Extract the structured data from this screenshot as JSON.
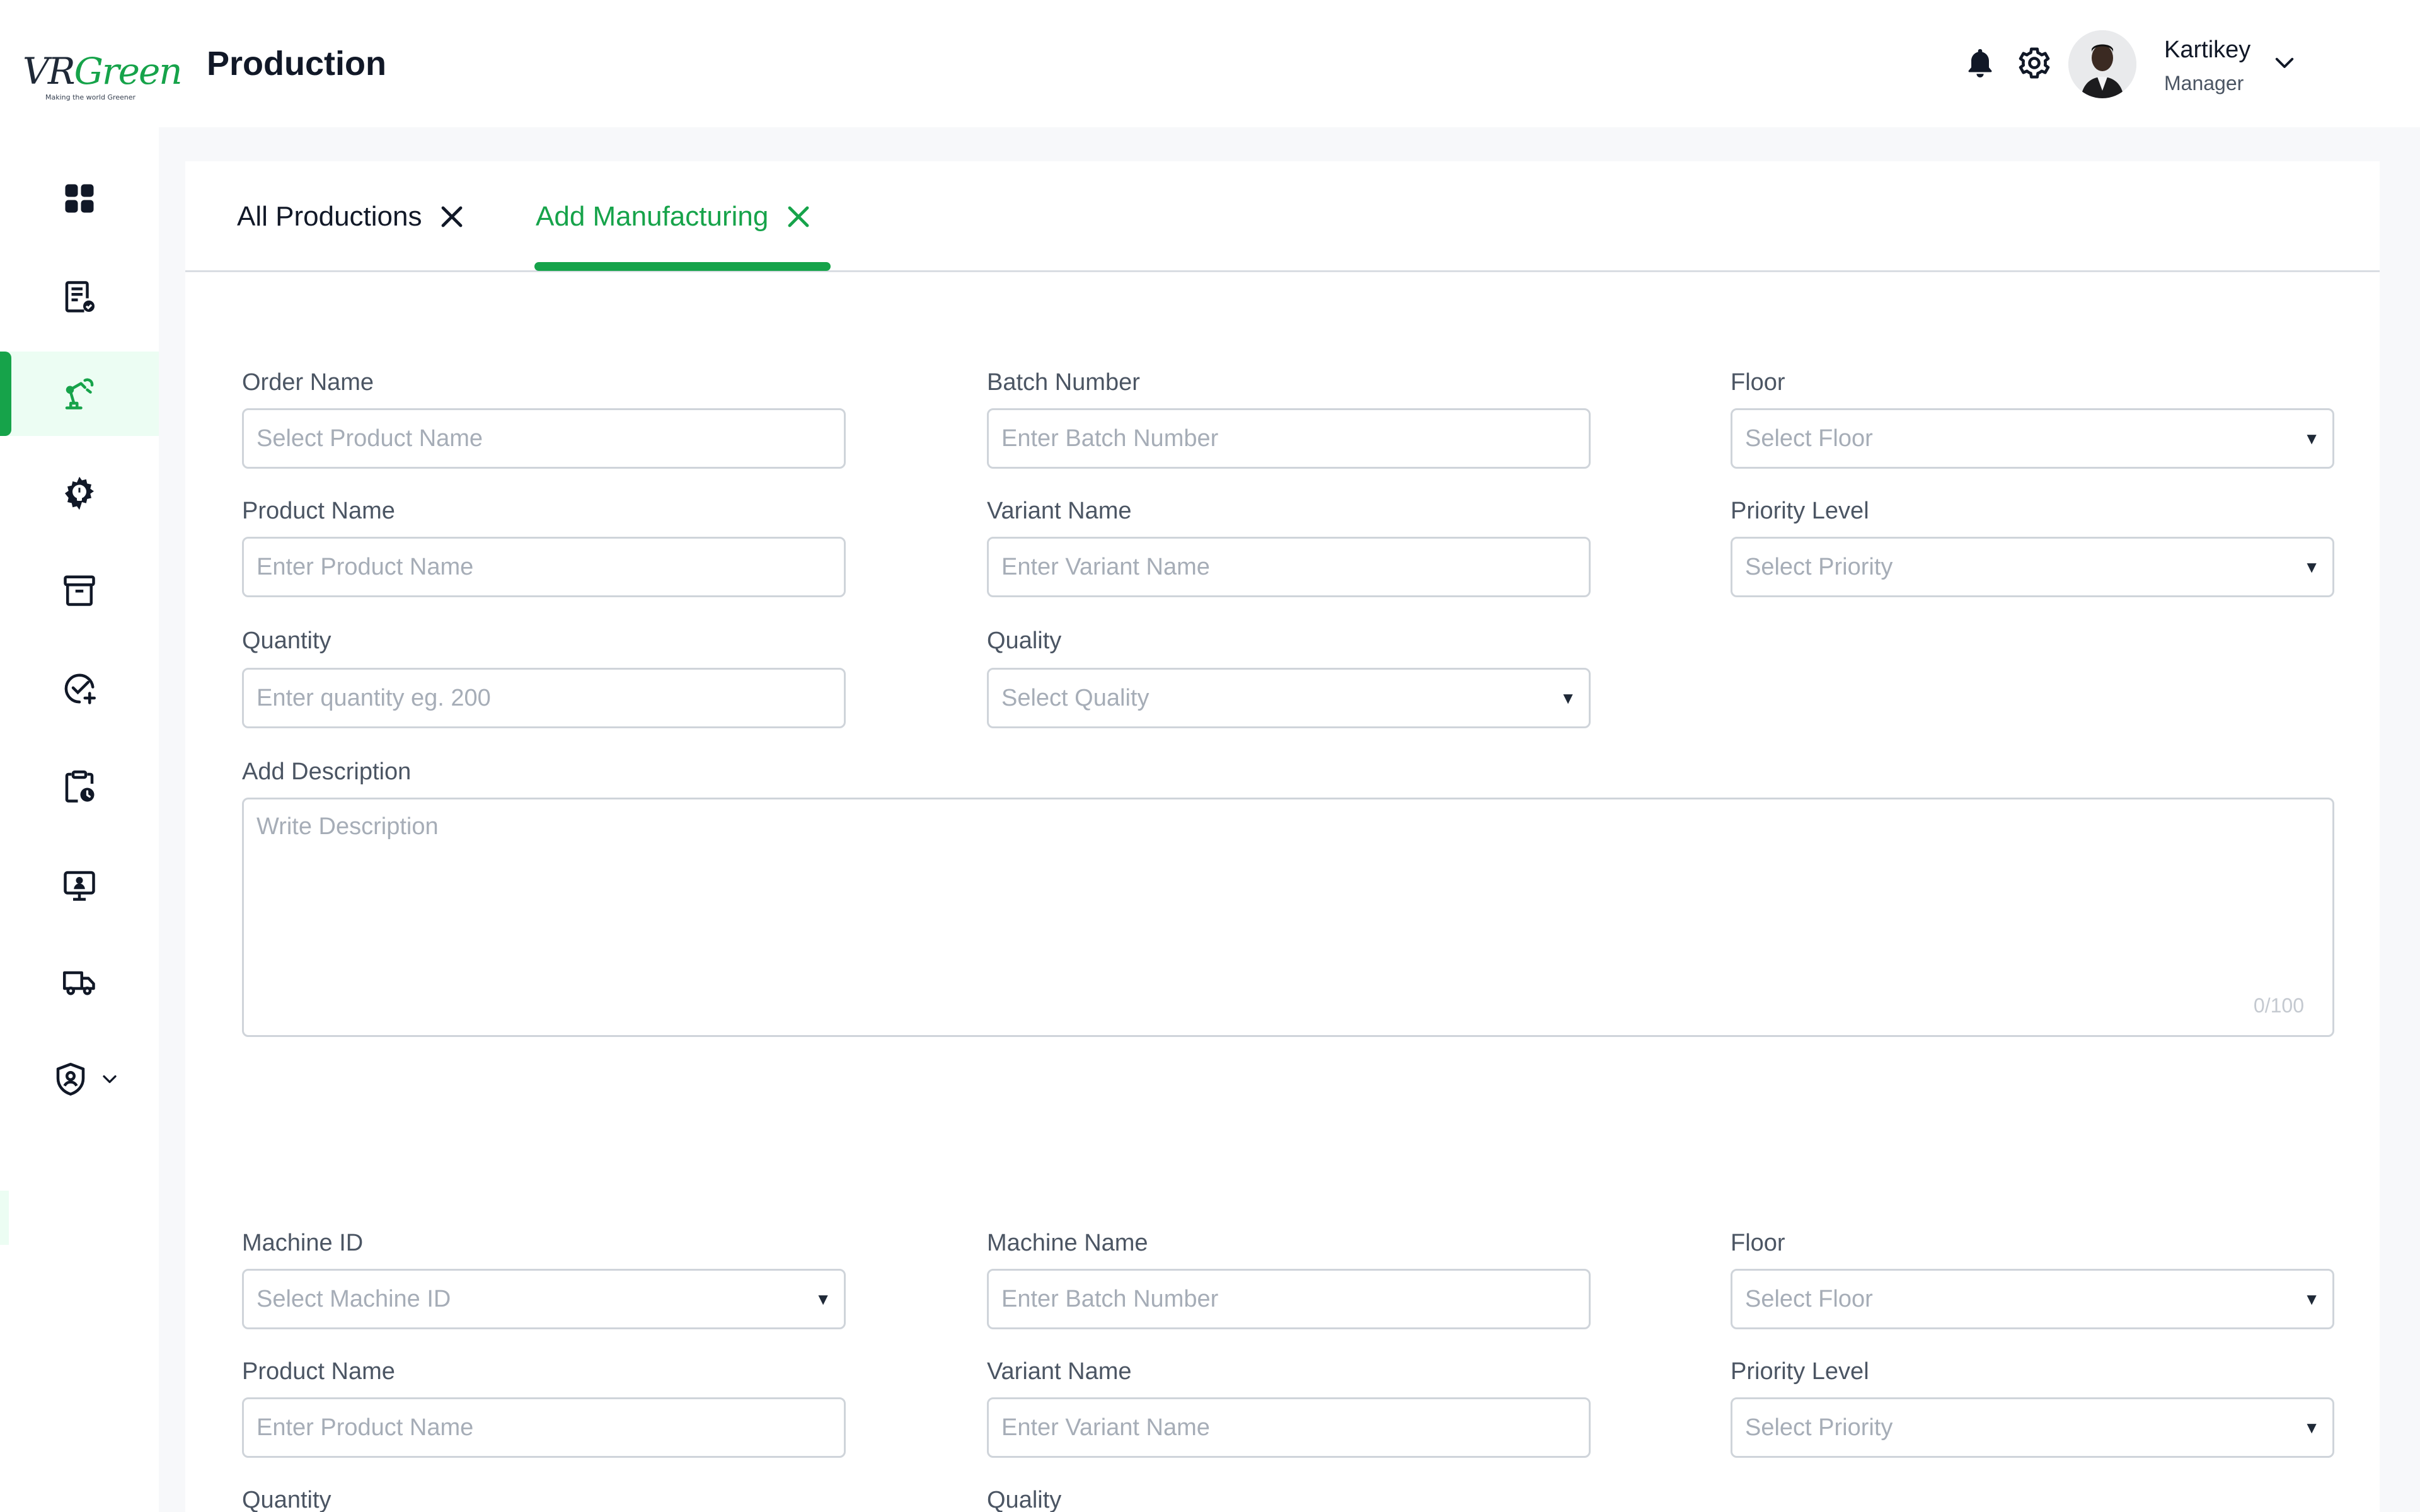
{
  "brand": {
    "logo_word_v": "VR",
    "logo_word_green": "Green",
    "logo_tagline": "Making the world Greener",
    "accent_color": "#16a34a"
  },
  "header": {
    "title": "Production",
    "icons": [
      "bell-icon",
      "settings-gear-icon"
    ],
    "user": {
      "name": "Kartikey",
      "role": "Manager"
    }
  },
  "sidebar": {
    "items": [
      {
        "icon": "dashboard-grid-icon",
        "active": false
      },
      {
        "icon": "orders-checklist-icon",
        "active": false
      },
      {
        "icon": "production-robot-arm-icon",
        "active": true
      },
      {
        "icon": "machine-gear-bulb-icon",
        "active": false
      },
      {
        "icon": "archive-box-icon",
        "active": false
      },
      {
        "icon": "approval-check-plus-icon",
        "active": false
      },
      {
        "icon": "clipboard-clock-icon",
        "active": false
      },
      {
        "icon": "monitor-user-icon",
        "active": false
      },
      {
        "icon": "delivery-truck-icon",
        "active": false
      },
      {
        "icon": "shield-user-icon",
        "active": false
      }
    ]
  },
  "tabs": [
    {
      "label": "All Productions",
      "active": false
    },
    {
      "label": "Add Manufacturing",
      "active": true
    }
  ],
  "form1": {
    "order_name": {
      "label": "Order Name",
      "placeholder": "Select Product Name"
    },
    "batch_number": {
      "label": "Batch Number",
      "placeholder": "Enter Batch Number"
    },
    "floor": {
      "label": "Floor",
      "placeholder": "Select Floor"
    },
    "product_name": {
      "label": "Product Name",
      "placeholder": "Enter Product Name"
    },
    "variant_name": {
      "label": "Variant Name",
      "placeholder": "Enter Variant Name"
    },
    "priority_level": {
      "label": "Priority Level",
      "placeholder": "Select Priority"
    },
    "quantity": {
      "label": "Quantity",
      "placeholder": "Enter quantity eg. 200"
    },
    "quality": {
      "label": "Quality",
      "placeholder": "Select Quality"
    },
    "description": {
      "label": "Add Description",
      "placeholder": "Write Description",
      "counter": "0/100"
    }
  },
  "form2": {
    "machine_id": {
      "label": "Machine ID",
      "placeholder": "Select Machine ID"
    },
    "machine_name": {
      "label": "Machine Name",
      "placeholder": "Enter Batch Number"
    },
    "floor": {
      "label": "Floor",
      "placeholder": "Select Floor"
    },
    "product_name": {
      "label": "Product Name",
      "placeholder": "Enter Product Name"
    },
    "variant_name": {
      "label": "Variant Name",
      "placeholder": "Enter Variant Name"
    },
    "priority_level": {
      "label": "Priority Level",
      "placeholder": "Select Priority"
    },
    "quantity": {
      "label": "Quantity"
    },
    "quality": {
      "label": "Quality"
    }
  },
  "select_arrow": "▼"
}
